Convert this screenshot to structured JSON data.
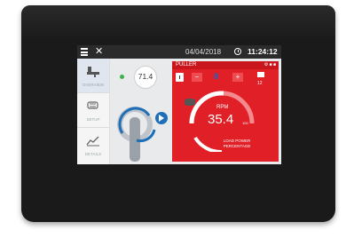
{
  "topbar": {
    "date": "04/04/2018",
    "time": "11:24:12"
  },
  "sidebar": {
    "items": [
      {
        "label": "OVERVIEW",
        "icon": "extruder-icon"
      },
      {
        "label": "SETUP",
        "icon": "motor-icon"
      },
      {
        "label": "DETAILS",
        "icon": "trend-chart-icon"
      }
    ]
  },
  "center": {
    "gauge_value": "71.4",
    "status_color": "#3bb54a"
  },
  "puller": {
    "title": "PULLER",
    "set_value": "8",
    "minus_label": "−",
    "plus_label": "+",
    "rpm_label": "RPM",
    "rpm_value": "35.4",
    "rpm_max": "100",
    "load_label": "LOAD POWER PERCENTAGE",
    "side_value": "12",
    "accent": "#e01f26"
  }
}
